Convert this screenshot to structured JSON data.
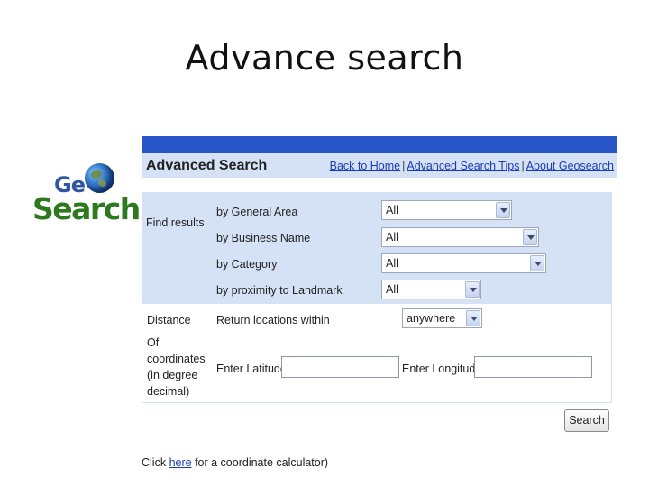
{
  "slide": {
    "title": "Advance search"
  },
  "logo": {
    "text_ge": "Ge",
    "text_search": "Search"
  },
  "header": {
    "title": "Advanced Search",
    "links": [
      "Back to Home",
      "Advanced Search Tips",
      "About Geosearch"
    ],
    "separator": "|"
  },
  "filters": {
    "section_label": "Find results",
    "rows": [
      {
        "label": "by General Area",
        "value": "All"
      },
      {
        "label": "by Business Name",
        "value": "All"
      },
      {
        "label": "by Category",
        "value": "All"
      },
      {
        "label": "by proximity to Landmark",
        "value": "All"
      }
    ]
  },
  "distance": {
    "section_label": "Distance",
    "label": "Return locations within",
    "value": "anywhere"
  },
  "coordinates": {
    "section_label_lines": [
      "Of",
      "coordinates",
      "(in degree",
      "decimal)"
    ],
    "latitude_label": "Enter Latitude:",
    "latitude_value": "",
    "longitude_label": "Enter Longitude",
    "longitude_value": ""
  },
  "search_button": "Search",
  "footnote": {
    "before": "Click ",
    "link": "here",
    "after": " for a coordinate calculator)"
  },
  "colors": {
    "topbar": "#2855c8",
    "panel_bg": "#d5e2f5",
    "link": "#1a3bb8",
    "logo_blue": "#2f55a3",
    "logo_green": "#2d7a1e"
  }
}
